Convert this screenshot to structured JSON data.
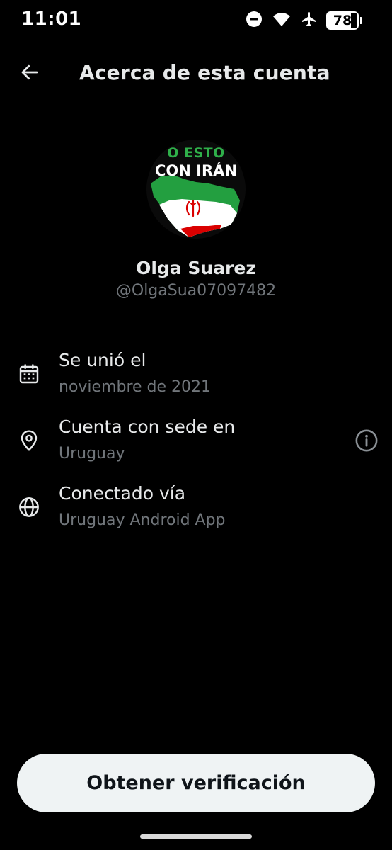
{
  "status_bar": {
    "time": "11:01",
    "battery_level": "78",
    "icons": [
      "do-not-disturb-icon",
      "wifi-icon",
      "airplane-icon",
      "battery-icon"
    ]
  },
  "header": {
    "title": "Acerca de esta cuenta",
    "back_icon": "arrow-left-icon"
  },
  "profile": {
    "avatar_text_top": "O ESTO",
    "avatar_text_main": "CON IRÁN",
    "name": "Olga Suarez",
    "handle": "@OlgaSua07097482"
  },
  "info": [
    {
      "icon": "calendar-icon",
      "label": "Se unió el",
      "value": "noviembre de 2021"
    },
    {
      "icon": "location-pin-icon",
      "label": "Cuenta con sede en",
      "value": "Uruguay",
      "action_icon": "info-icon"
    },
    {
      "icon": "globe-icon",
      "label": "Conectado vía",
      "value": "Uruguay Android App"
    }
  ],
  "footer": {
    "verify_label": "Obtener verificación"
  },
  "colors": {
    "background": "#000000",
    "primary_text": "#e7e9ea",
    "secondary_text": "#71767b",
    "button_bg": "#eff3f4",
    "button_text": "#0f1419"
  }
}
